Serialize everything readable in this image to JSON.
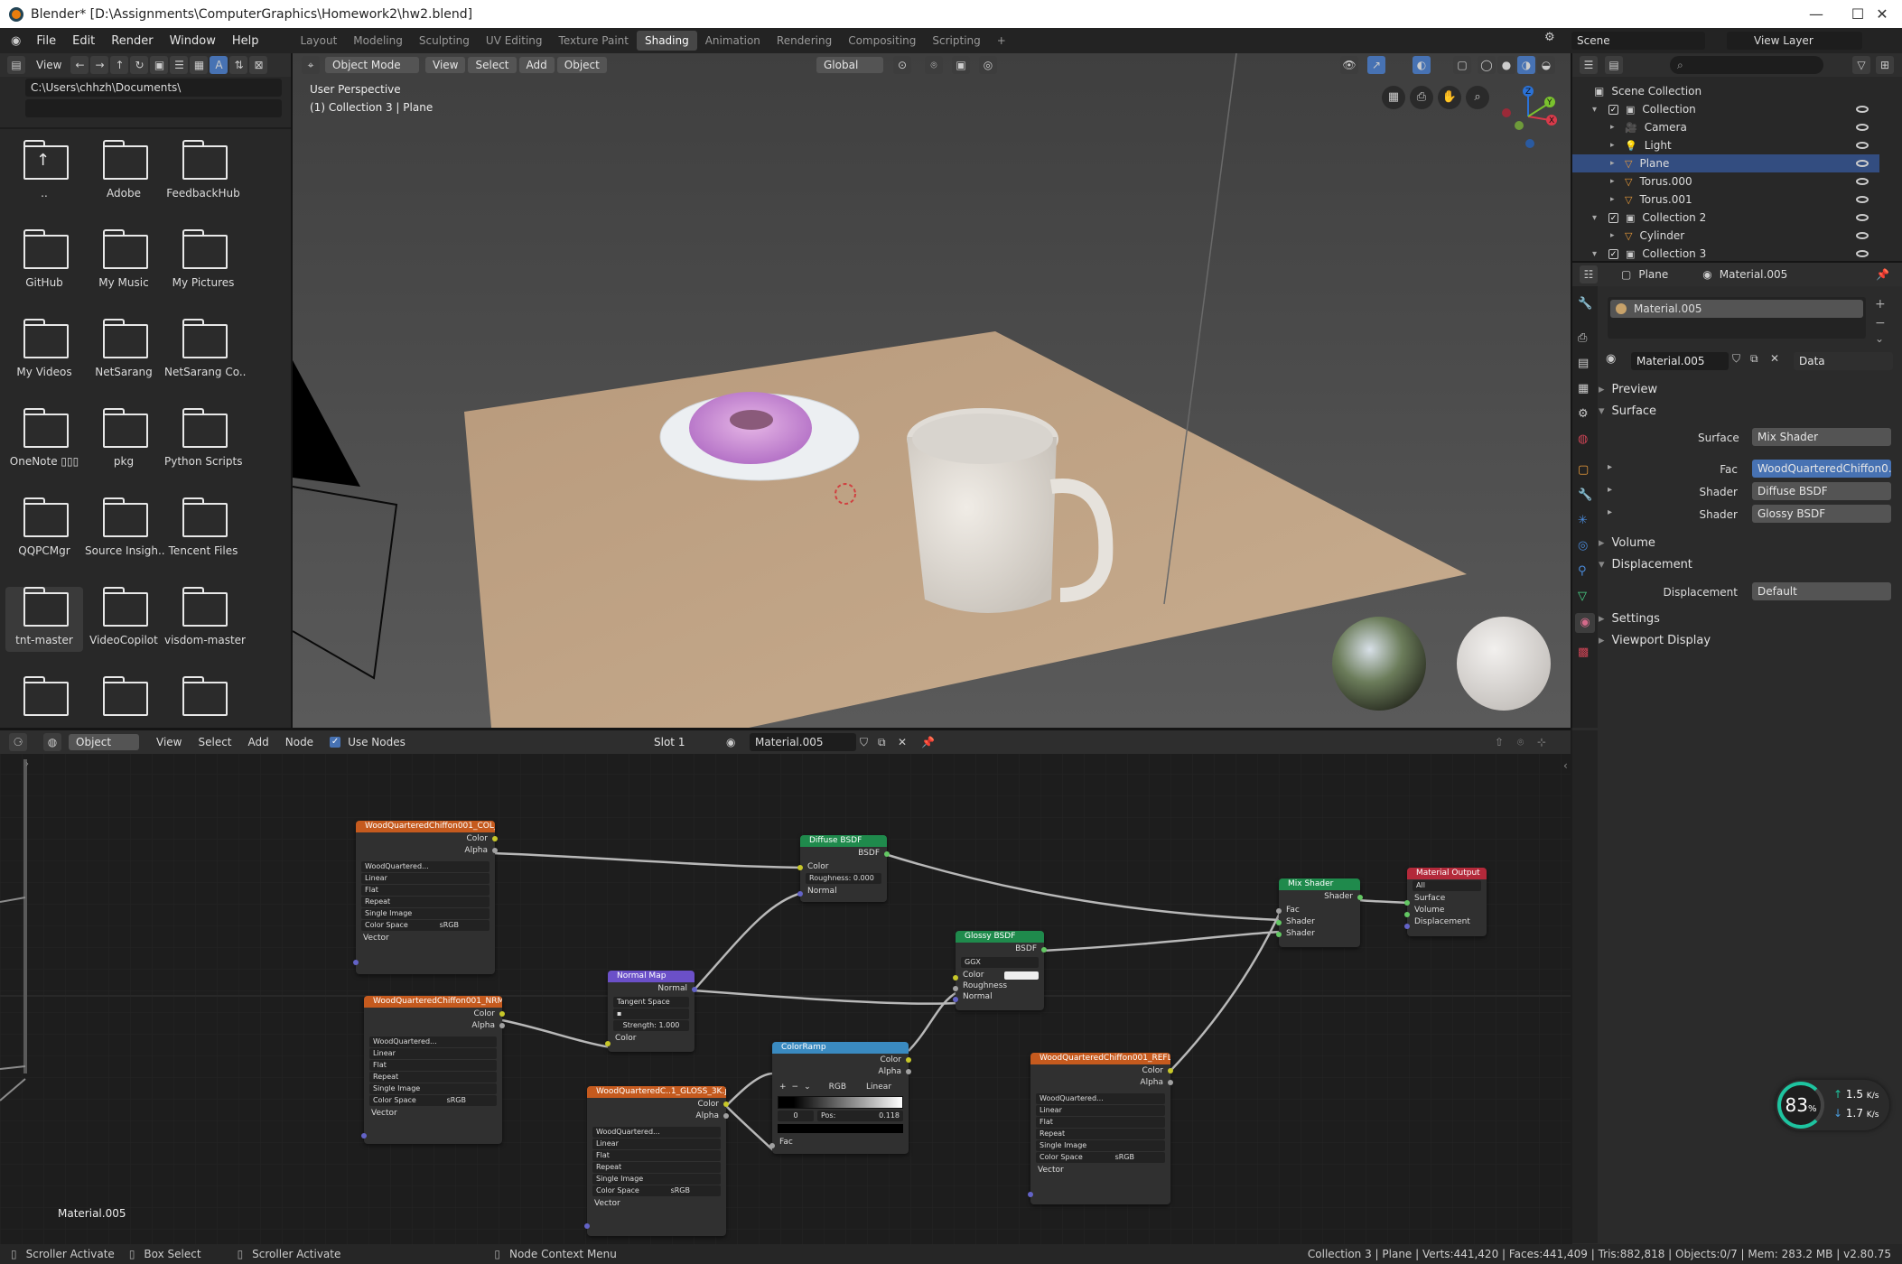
{
  "window": {
    "title": "Blender* [D:\\Assignments\\ComputerGraphics\\Homework2\\hw2.blend]"
  },
  "menu": [
    "File",
    "Edit",
    "Render",
    "Window",
    "Help"
  ],
  "workspaces": [
    "Layout",
    "Modeling",
    "Sculpting",
    "UV Editing",
    "Texture Paint",
    "Shading",
    "Animation",
    "Rendering",
    "Compositing",
    "Scripting"
  ],
  "active_workspace": "Shading",
  "scene": {
    "name": "Scene",
    "view_layer": "View Layer"
  },
  "file_browser": {
    "view_label": "View",
    "path": "C:\\Users\\chhzh\\Documents\\",
    "items": [
      "..",
      "Adobe",
      "FeedbackHub",
      "GitHub",
      "My Music",
      "My Pictures",
      "My Videos",
      "NetSarang",
      "NetSarang Co..",
      "OneNote ▯▯▯",
      "pkg",
      "Python Scripts",
      "QQPCMgr",
      "Source Insigh..",
      "Tencent Files",
      "tnt-master",
      "VideoCopilot",
      "visdom-master",
      "",
      "",
      ""
    ]
  },
  "viewport": {
    "mode": "Object Mode",
    "menus": [
      "View",
      "Select",
      "Add",
      "Object"
    ],
    "orientation": "Global",
    "overlay_title": "User Perspective",
    "overlay_sub": "(1) Collection 3 | Plane",
    "axes": {
      "x": "X",
      "y": "Y",
      "z": "Z"
    }
  },
  "outliner": {
    "title": "Scene Collection",
    "rows": [
      {
        "label": "Collection",
        "icon": "collection-icon"
      },
      {
        "label": "Camera",
        "icon": "camera-icon"
      },
      {
        "label": "Light",
        "icon": "light-icon"
      },
      {
        "label": "Plane",
        "icon": "mesh-icon"
      },
      {
        "label": "Torus.000",
        "icon": "mesh-icon"
      },
      {
        "label": "Torus.001",
        "icon": "mesh-icon"
      },
      {
        "label": "Collection 2",
        "icon": "collection-icon"
      },
      {
        "label": "Cylinder",
        "icon": "mesh-icon"
      },
      {
        "label": "Collection 3",
        "icon": "collection-icon"
      }
    ]
  },
  "properties": {
    "object": "Plane",
    "material_tab": "Material.005",
    "slot": "Material.005",
    "material": "Material.005",
    "link": "Data",
    "sections": {
      "preview": "Preview",
      "surface": "Surface",
      "volume": "Volume",
      "displacement": "Displacement",
      "settings": "Settings",
      "viewport_display": "Viewport Display"
    },
    "surface_label": "Surface",
    "surface_value": "Mix Shader",
    "fac_label": "Fac",
    "fac_value": "WoodQuarteredChiffon0...",
    "shader1_label": "Shader",
    "shader1_value": "Diffuse BSDF",
    "shader2_label": "Shader",
    "shader2_value": "Glossy BSDF",
    "disp_label": "Displacement",
    "disp_value": "Default"
  },
  "node_editor": {
    "object": "Object",
    "menus": [
      "View",
      "Select",
      "Add",
      "Node"
    ],
    "use_nodes": "Use Nodes",
    "slot": "Slot 1",
    "material": "Material.005",
    "footer_material": "Material.005",
    "nodes": {
      "col": {
        "title": "WoodQuarteredChiffon001_COL_3...",
        "out1": "Color",
        "out2": "Alpha",
        "img": "WoodQuartered...",
        "o1": "Linear",
        "o2": "Flat",
        "o3": "Repeat",
        "o4": "Single Image",
        "cs_label": "Color Space",
        "cs": "sRGB",
        "in": "Vector"
      },
      "nrm": {
        "title": "WoodQuarteredChiffon001_NRM_3...",
        "out1": "Color",
        "out2": "Alpha",
        "img": "WoodQuartered...",
        "o1": "Linear",
        "o2": "Flat",
        "o3": "Repeat",
        "o4": "Single Image",
        "cs_label": "Color Space",
        "cs": "sRGB",
        "in": "Vector"
      },
      "gloss": {
        "title": "WoodQuarteredC..1_GLOSS_3K.jpg",
        "out1": "Color",
        "out2": "Alpha",
        "img": "WoodQuartered...",
        "o1": "Linear",
        "o2": "Flat",
        "o3": "Repeat",
        "o4": "Single Image",
        "cs_label": "Color Space",
        "cs": "sRGB",
        "in": "Vector"
      },
      "refl": {
        "title": "WoodQuarteredChiffon001_REFL_...",
        "out1": "Color",
        "out2": "Alpha",
        "img": "WoodQuartered...",
        "o1": "Linear",
        "o2": "Flat",
        "o3": "Repeat",
        "o4": "Single Image",
        "cs_label": "Color Space",
        "cs": "sRGB",
        "in": "Vector"
      },
      "diffuse": {
        "title": "Diffuse BSDF",
        "out": "BSDF",
        "in1": "Color",
        "in2": "Roughness: 0.000",
        "in3": "Normal"
      },
      "normalmap": {
        "title": "Normal Map",
        "out": "Normal",
        "space": "Tangent Space",
        "strength": "Strength: 1.000",
        "in": "Color"
      },
      "glossy": {
        "title": "Glossy BSDF",
        "out": "BSDF",
        "dist": "GGX",
        "in1": "Color",
        "in2": "Roughness",
        "in3": "Normal"
      },
      "ramp": {
        "title": "ColorRamp",
        "out1": "Color",
        "out2": "Alpha",
        "mode": "RGB",
        "interp": "Linear",
        "idx": "0",
        "pos": "Pos:",
        "posval": "0.118",
        "in": "Fac"
      },
      "mix": {
        "title": "Mix Shader",
        "out": "Shader",
        "in1": "Fac",
        "in2": "Shader",
        "in3": "Shader"
      },
      "output": {
        "title": "Material Output",
        "target": "All",
        "in1": "Surface",
        "in2": "Volume",
        "in3": "Displacement"
      }
    }
  },
  "perf": {
    "percent": "83",
    "unit": "%",
    "up": "1.5",
    "down": "1.7",
    "rate_unit": "K/s"
  },
  "statusbar": {
    "left1": "Scroller Activate",
    "left2": "Box Select",
    "left3": "Scroller Activate",
    "left4": "Node Context Menu",
    "right": "Collection 3 | Plane | Verts:441,420 | Faces:441,409 | Tris:882,818 | Objects:0/7 | Mem: 283.2 MB | v2.80.75"
  },
  "colors": {
    "accent": "#4772b3",
    "texture_header": "#c55a1e",
    "shader_header": "#1f8a4c",
    "vector_header": "#6b50c8",
    "converter_header": "#3a8ac0",
    "output_header": "#b3293a"
  }
}
